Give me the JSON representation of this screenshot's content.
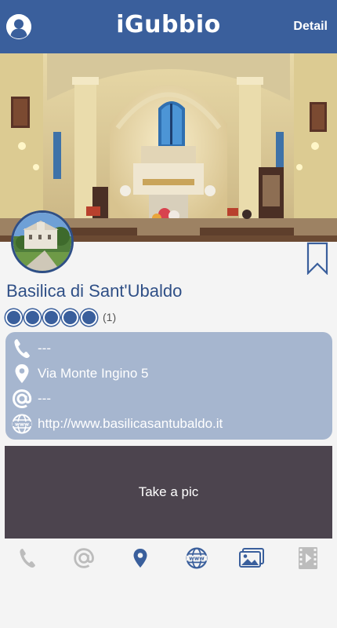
{
  "header": {
    "brand": "iGubbio",
    "detail_label": "Detail",
    "bar_color": "#3a5f9c",
    "profile_icon": "user-avatar-icon"
  },
  "place": {
    "name": "Basilica di Sant'Ubaldo",
    "rating_dots": 5,
    "rating_count": "(1)",
    "bookmark_icon": "bookmark-icon"
  },
  "contact": {
    "phone": "---",
    "address": "Via Monte Ingino 5",
    "email": "---",
    "website": "http://www.basilicasantubaldo.it"
  },
  "camera": {
    "label": "Take a pic"
  },
  "tabs": [
    {
      "name": "phone",
      "icon": "phone-icon",
      "active": false
    },
    {
      "name": "email",
      "icon": "at-icon",
      "active": false
    },
    {
      "name": "map",
      "icon": "map-pin-icon",
      "active": true
    },
    {
      "name": "web",
      "icon": "globe-www-icon",
      "active": true
    },
    {
      "name": "gallery",
      "icon": "photo-gallery-icon",
      "active": true
    },
    {
      "name": "video",
      "icon": "film-icon",
      "active": false
    }
  ],
  "colors": {
    "accent": "#3a5f9c",
    "title": "#2f4f86",
    "card": "#a6b6cf",
    "camera_panel": "#4c444e",
    "inactive_icon": "#bcbcbc"
  }
}
